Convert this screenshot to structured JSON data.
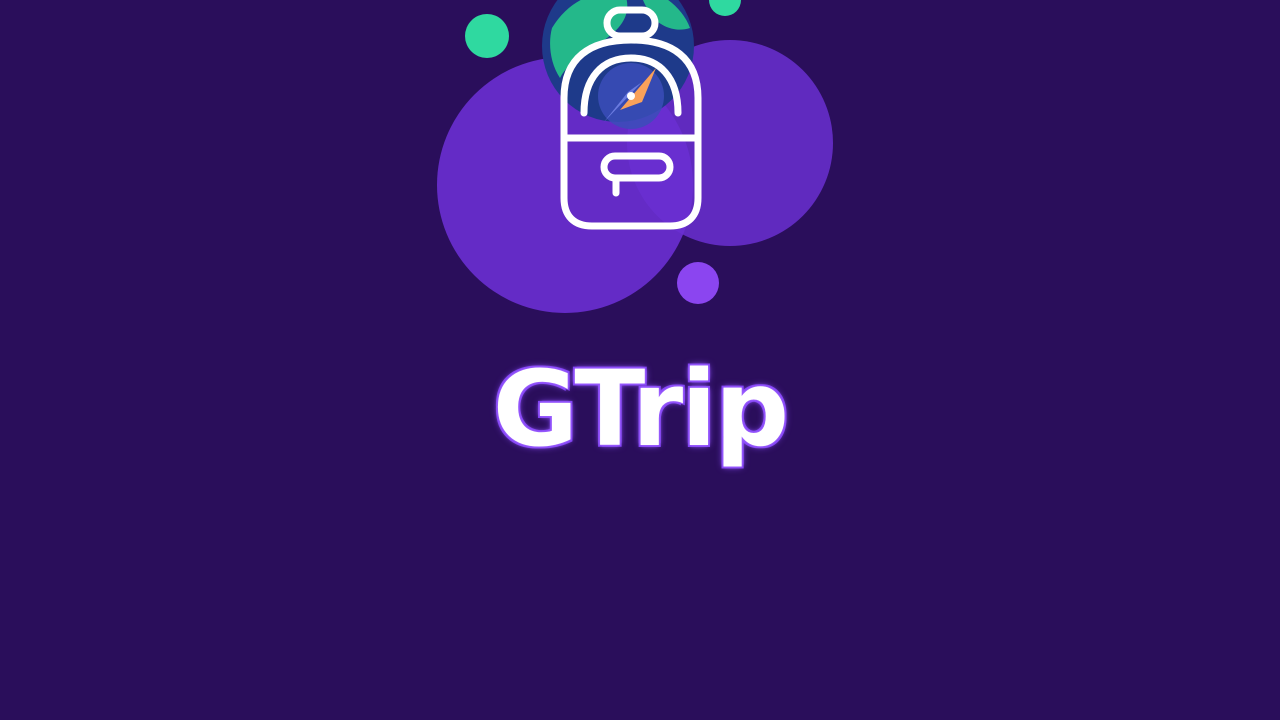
{
  "app": {
    "name": "GTrip"
  },
  "colors": {
    "background": "#2a0e5b",
    "bubble_purple": "#6a2fd1",
    "bubble_green": "#2fd9a0",
    "globe_blue": "#1e3a8a",
    "globe_green": "#24b88a",
    "compass_orange": "#f47a2a",
    "glow": "#8a4dff",
    "text": "#ffffff"
  },
  "icons": {
    "logo": "backpack-compass-logo-icon"
  }
}
